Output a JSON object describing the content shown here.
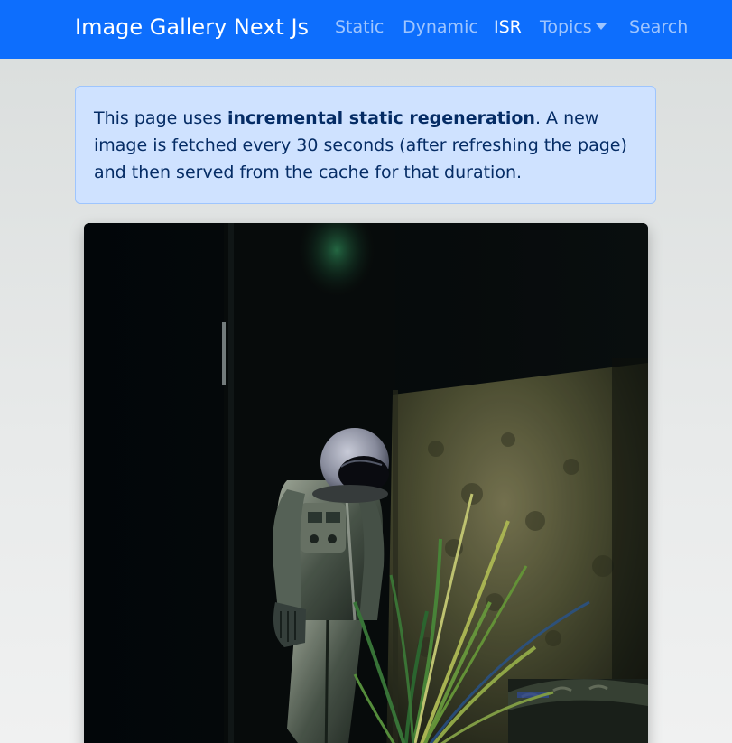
{
  "navbar": {
    "brand": "Image Gallery Next Js",
    "links": [
      {
        "label": "Static",
        "active": false
      },
      {
        "label": "Dynamic",
        "active": false
      },
      {
        "label": "ISR",
        "active": true
      },
      {
        "label": "Topics",
        "active": false,
        "dropdown": true
      },
      {
        "label": "Search",
        "active": false
      }
    ],
    "background": "#0d6efd"
  },
  "alert": {
    "prefix": "This page uses ",
    "emphasis": "incremental static regeneration",
    "suffix": ". A new image is fetched every 30 seconds (after refreshing the page) and then served from the cache for that duration.",
    "background": "#cfe2ff",
    "border": "#9ec5fe"
  },
  "photo": {
    "subject": "astronaut standing in a dark room beside a potted plant"
  },
  "icons": {
    "topics_dropdown": "caret-down-icon"
  }
}
